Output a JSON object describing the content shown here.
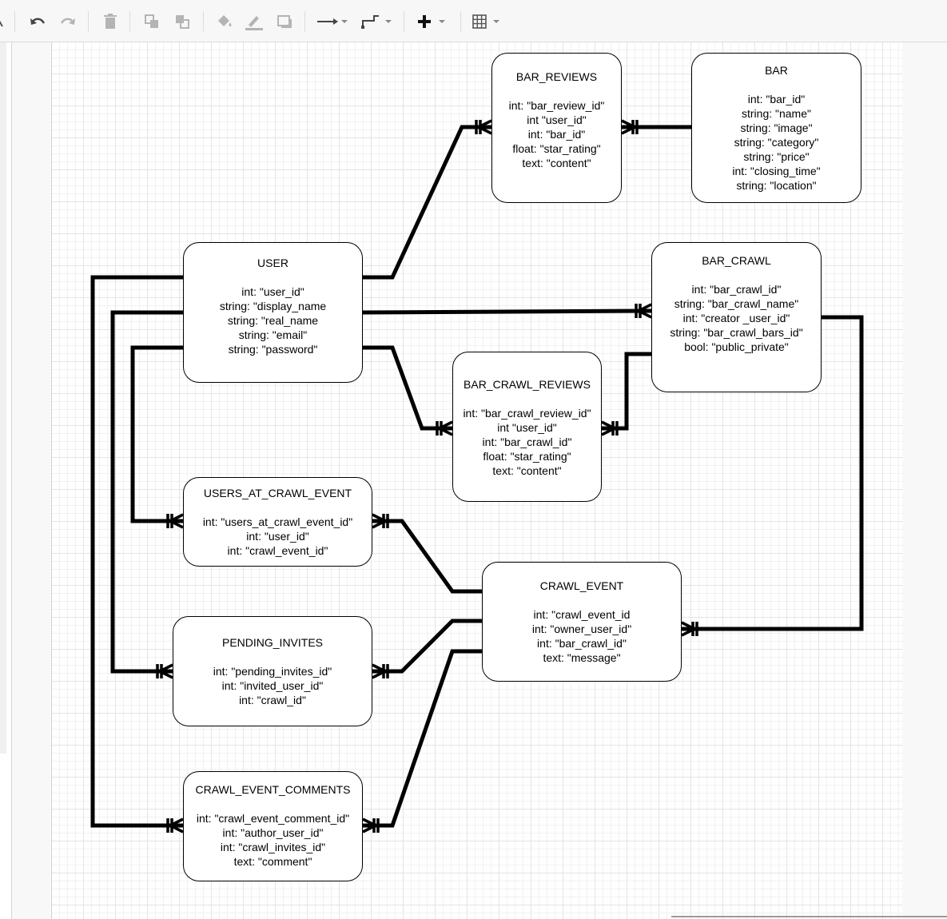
{
  "toolbar": {
    "buttons": [
      {
        "name": "pointer-icon"
      },
      {
        "name": "undo-icon"
      },
      {
        "name": "redo-icon"
      },
      {
        "name": "delete-icon"
      },
      {
        "name": "to-front-icon"
      },
      {
        "name": "to-back-icon"
      },
      {
        "name": "fill-color-icon"
      },
      {
        "name": "line-color-icon"
      },
      {
        "name": "shadow-icon"
      },
      {
        "name": "connection-arrow-icon"
      },
      {
        "name": "waypoints-icon"
      },
      {
        "name": "insert-plus-icon"
      },
      {
        "name": "table-icon"
      }
    ]
  },
  "entities": [
    {
      "id": "bar_reviews",
      "title": "BAR_REVIEWS",
      "fields": [
        "int: \"bar_review_id\"",
        "int \"user_id\"",
        "int: \"bar_id\"",
        "float: \"star_rating\"",
        "text: \"content\""
      ]
    },
    {
      "id": "bar",
      "title": "BAR",
      "fields": [
        "int: \"bar_id\"",
        "string: \"name\"",
        "string: \"image\"",
        "string: \"category\"",
        "string: \"price\"",
        "int: \"closing_time\"",
        "string: \"location\""
      ]
    },
    {
      "id": "user",
      "title": "USER",
      "fields": [
        "int: \"user_id\"",
        "string: \"display_name",
        "string: \"real_name",
        "string: \"email\"",
        "string: \"password\""
      ]
    },
    {
      "id": "bar_crawl",
      "title": "BAR_CRAWL",
      "fields": [
        "int: \"bar_crawl_id\"",
        "string: \"bar_crawl_name\"",
        "int: \"creator _user_id\"",
        "string: \"bar_crawl_bars_id\"",
        "bool: \"public_private\""
      ]
    },
    {
      "id": "bar_crawl_reviews",
      "title": "BAR_CRAWL_REVIEWS",
      "fields": [
        "int: \"bar_crawl_review_id\"",
        "int \"user_id\"",
        "int: \"bar_crawl_id\"",
        "float: \"star_rating\"",
        "text: \"content\""
      ]
    },
    {
      "id": "users_at_crawl_event",
      "title": "USERS_AT_CRAWL_EVENT",
      "fields": [
        "int: \"users_at_crawl_event_id\"",
        "int: \"user_id\"",
        "int: \"crawl_event_id\""
      ]
    },
    {
      "id": "crawl_event",
      "title": "CRAWL_EVENT",
      "fields": [
        "int: \"crawl_event_id",
        "int: \"owner_user_id\"",
        "int: \"bar_crawl_id\"",
        "text: \"message\""
      ]
    },
    {
      "id": "pending_invites",
      "title": "PENDING_INVITES",
      "fields": [
        "int: \"pending_invites_id\"",
        "int: \"invited_user_id\"",
        "int: \"crawl_id\""
      ]
    },
    {
      "id": "crawl_event_comments",
      "title": "CRAWL_EVENT_COMMENTS",
      "fields": [
        "int: \"crawl_event_comment_id\"",
        "int: \"author_user_id\"",
        "int: \"crawl_invites_id\"",
        "text: \"comment\""
      ]
    }
  ],
  "relationships": [
    {
      "from": "user",
      "to": "bar_reviews",
      "cardinality": "one-to-many"
    },
    {
      "from": "bar",
      "to": "bar_reviews",
      "cardinality": "one-to-many"
    },
    {
      "from": "user",
      "to": "bar_crawl",
      "cardinality": "one-to-many"
    },
    {
      "from": "user",
      "to": "bar_crawl_reviews",
      "cardinality": "one-to-many"
    },
    {
      "from": "bar_crawl",
      "to": "bar_crawl_reviews",
      "cardinality": "one-to-many"
    },
    {
      "from": "user",
      "to": "users_at_crawl_event",
      "cardinality": "one-to-many"
    },
    {
      "from": "crawl_event",
      "to": "users_at_crawl_event",
      "cardinality": "one-to-many"
    },
    {
      "from": "bar_crawl",
      "to": "crawl_event",
      "cardinality": "one-to-many"
    },
    {
      "from": "user",
      "to": "pending_invites",
      "cardinality": "one-to-many"
    },
    {
      "from": "crawl_event",
      "to": "pending_invites",
      "cardinality": "one-to-many"
    },
    {
      "from": "user",
      "to": "crawl_event_comments",
      "cardinality": "one-to-many"
    },
    {
      "from": "crawl_event",
      "to": "crawl_event_comments",
      "cardinality": "one-to-many"
    }
  ]
}
